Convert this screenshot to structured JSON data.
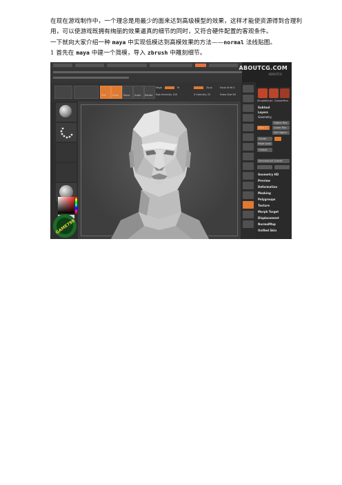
{
  "doc": {
    "p1": "在现在游戏制作中，一个理念是用最少的面来达到高级模型的效果，这样才能使资源得到合理利用，可以使游戏既拥有绚丽的效果逼真的细节的同时，又符合硬件配置的客观条件。",
    "p2_a": "一下就向大家介绍一种 ",
    "p2_maya": "maya",
    "p2_b": " 中实现低模达到高模效果的方法——",
    "p2_normal": "normal",
    "p2_c": " 法线贴图。",
    "p3_a": "1 首先在 ",
    "p3_maya": "maya",
    "p3_b": " 中建一个简模，导入 ",
    "p3_zbrush": "zbrush",
    "p3_c": " 中雕刻细节。"
  },
  "screenshot": {
    "watermark": "ABOUTCG.COM",
    "watermark_sub": "ABOUTCG",
    "badge_text": "GAME798",
    "palette": {
      "top_labels": [
        "SimpleBrush",
        "PolyMesh3D",
        "GrasshPers"
      ],
      "subtool": "Subtool",
      "layers": "Layers",
      "geometry": "Geometry",
      "higher_res": "Higher Res",
      "lower_res": "Lower Res",
      "sdiv": "SDiv 1",
      "del_higher": "Del Higher",
      "divide": "Divide",
      "edge_loop": "Edge Loop",
      "crease": "Crease",
      "reconstruct": "Reconstruct Subdiv",
      "geometry_hd": "Geometry HD",
      "preview": "Preview",
      "deformation": "Deformation",
      "masking": "Masking",
      "polygroups": "Polygroups",
      "texture": "Texture",
      "morph_target": "Morph Target",
      "displacement": "Displacement",
      "normalmap": "NormalMap",
      "unified_skin": "Unified Skin"
    },
    "toolbar": {
      "edit": "Edit",
      "draw": "Draw",
      "move": "Move",
      "scale": "Scale",
      "rotate": "Rotate",
      "mrgb": "Mrgb",
      "rgb": "Rgb",
      "m": "M",
      "zadd": "Zadd",
      "zsub": "Zsub",
      "focal_shift": "Focal Shift 0",
      "draw_size": "Draw Size 64",
      "rgb_intensity": "Rgb Intensity 100",
      "z_intensity": "Z Intensity 25"
    }
  }
}
